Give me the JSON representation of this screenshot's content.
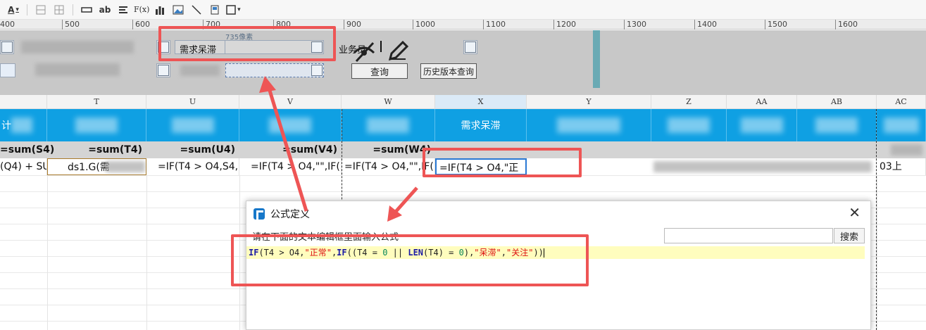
{
  "toolbar": {
    "items": [
      {
        "icon": "font-color-icon",
        "label": "A"
      },
      {
        "icon": "cell-style-icon",
        "label": ""
      },
      {
        "icon": "table-icon",
        "label": ""
      },
      {
        "icon": "merge-icon",
        "label": ""
      },
      {
        "icon": "text-icon",
        "label": "ab"
      },
      {
        "icon": "align-icon",
        "label": ""
      },
      {
        "icon": "formula-icon",
        "label": "F(x)"
      },
      {
        "icon": "chart-icon",
        "label": ""
      },
      {
        "icon": "image-icon",
        "label": ""
      },
      {
        "icon": "slash-icon",
        "label": ""
      },
      {
        "icon": "sub-report-icon",
        "label": ""
      },
      {
        "icon": "border-icon",
        "label": ""
      }
    ]
  },
  "ruler": {
    "ticks": [
      "400",
      "500",
      "600",
      "700",
      "800",
      "900",
      "1000",
      "1100",
      "1200",
      "1300",
      "1400",
      "1500",
      "1600"
    ]
  },
  "params": {
    "width_hint": "735像素",
    "field_demand_label": "需求呆滞",
    "salesman_label": "业务员",
    "query_button": "查询",
    "history_button": "历史版本查询"
  },
  "grid": {
    "columns": [
      "T",
      "U",
      "V",
      "W",
      "X",
      "Y",
      "Z",
      "AA",
      "AB",
      "AC"
    ],
    "header_partial": "计",
    "header_x": "需求呆滞",
    "sums": [
      "=sum(S4)",
      "=sum(T4)",
      "=sum(U4)",
      "=sum(V4)",
      "=sum(W4)"
    ],
    "formulas": [
      "(Q4) + SU",
      "ds1.G(需",
      "=IF(T4 > O4,S4,I",
      "=IF(T4 > O4,\"\",IF(",
      "=IF(T4 > O4,\"\",IF(",
      "=IF(T4 > O4,\"正"
    ],
    "tail_text": "03上"
  },
  "dialog": {
    "title": "公式定义",
    "prompt": "请在下面的文本编辑框里面输入公式",
    "search_button": "搜索",
    "formula": "IF(T4 > O4,\"正常\",IF((T4 = 0 || LEN(T4) = 0),\"呆滞\",\"关注\"))"
  },
  "colors": {
    "accent_blue": "#0fa0e3",
    "annotation_red": "#ee5555",
    "editor_highlight": "#fffdbe"
  }
}
